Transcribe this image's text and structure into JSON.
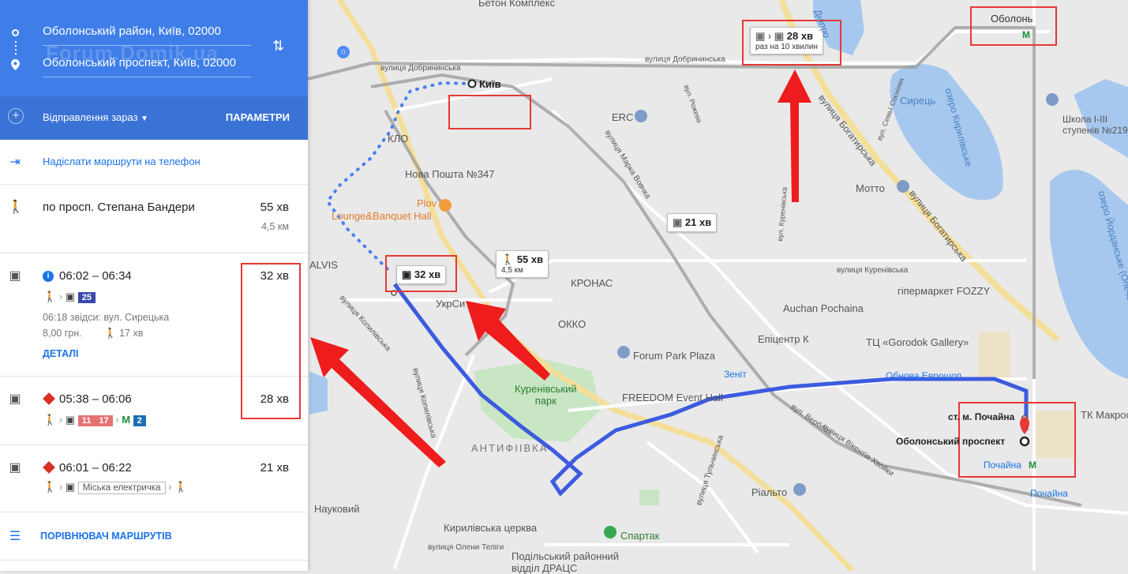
{
  "sidebar": {
    "origin": "Оболонський район, Київ, 02000",
    "destination": "Оболонський проспект, Київ, 02000",
    "watermark": "Forum.Domik.ua",
    "depart_label": "Відправлення зараз",
    "options_label": "ПАРАМЕТРИ",
    "send_to_phone": "Надіслати маршрути на телефон",
    "routes": [
      {
        "title": "по просп. Степана Бандери",
        "duration": "55 хв",
        "distance": "4,5 км"
      },
      {
        "time": "06:02 – 06:34",
        "duration": "32 хв",
        "bus": "25",
        "departure_info": "06:18 звідси: вул. Сирецька",
        "fare": "8,00 грн.",
        "walk": "17 хв",
        "details": "ДЕТАЛІ"
      },
      {
        "time": "05:38 – 06:06",
        "duration": "28 хв",
        "buses": [
          "11",
          "17"
        ],
        "metro": "2"
      },
      {
        "time": "06:01 – 06:22",
        "duration": "21 хв",
        "train": "Міська електричка"
      }
    ],
    "compare": "ПОРІВНЮВАЧ МАРШРУТІВ"
  },
  "map": {
    "bubbles": {
      "route28": "28 хв",
      "route28_sub": "раз на 10 хвилин",
      "route21": "21 хв",
      "route55": "55 хв",
      "route55_sub": "4,5 км",
      "route32": "32 хв"
    },
    "labels": {
      "kyiv": "Київ",
      "start_stop": "ст. м. Почайна",
      "end": "Оболонський проспект",
      "obolon": "Оболонь",
      "pochaina1": "Почайна",
      "pochaina2": "Почайна",
      "betons": "Бетон Комплекс",
      "dnipro": "Дніпро",
      "syrets": "Сирець",
      "lake_kyryl": "озеро Кирилівське",
      "lake_yord": "озеро Йорданське (Опечен",
      "school": "Школа І-ІІІ\nступенів №219",
      "motto": "Мотто",
      "erc": "ERC",
      "nova": "Нова Пошта №347",
      "plov": "Plov",
      "lounge": "Lounge&Banquet Hall",
      "klo": "КЛО",
      "alvis": "ALVIS",
      "ukrsib": "УкрСи",
      "okko": "ОККО",
      "kronas": "КРОНАС",
      "auchan": "Auchan Pochaina",
      "fozzy": "гіпермаркет FOZZY",
      "epicentr": "Епіцентр К",
      "gorodok": "ТЦ «Gorodok Gallery»",
      "forum_park": "Forum Park Plaza",
      "zenit": "Зеніт",
      "evrosho": "Обнова Еврошоп",
      "freedom": "FREEDOM Event Hall",
      "kurenivskyi": "Куренівський\nпарк",
      "antyfiivka": "АНТИФІІВКА",
      "rialto": "Ріальто",
      "naukovyi": "Науковий",
      "kyrylivska_ts": "Кирилівська церква",
      "spartak": "Спартак",
      "podilskyi": "Подільський районний\nвідділ ДРАЦС",
      "tk_makros": "ТК Макрос",
      "st_dobrynynska": "вулиця Добрининська",
      "st_dobrynynska2": "вулиця Добрининська",
      "st_marka": "вулиця Марка Вовчка",
      "st_bohatyrska": "вулиця Богатирська",
      "st_bohatyrska2": "вулиця Богатирська",
      "st_kurenivska": "вулиця Куренівська",
      "st_kopylivska": "вулиця Копилівська",
      "st_kopylivska2": "вулиця Копилівська",
      "st_verbova": "вул. Вербова",
      "st_olena": "вулиця Олени Теліги",
      "st_tulchynska": "вулиця Тульчинська",
      "st_vikentiia": "вулиця Вікентія Хвойки",
      "st_rozova": "вул. Рожева",
      "st_syrets_vul": "вул. Семьї Сосніних",
      "st_kurenivskyi_per": "вул. Куренівська"
    }
  }
}
